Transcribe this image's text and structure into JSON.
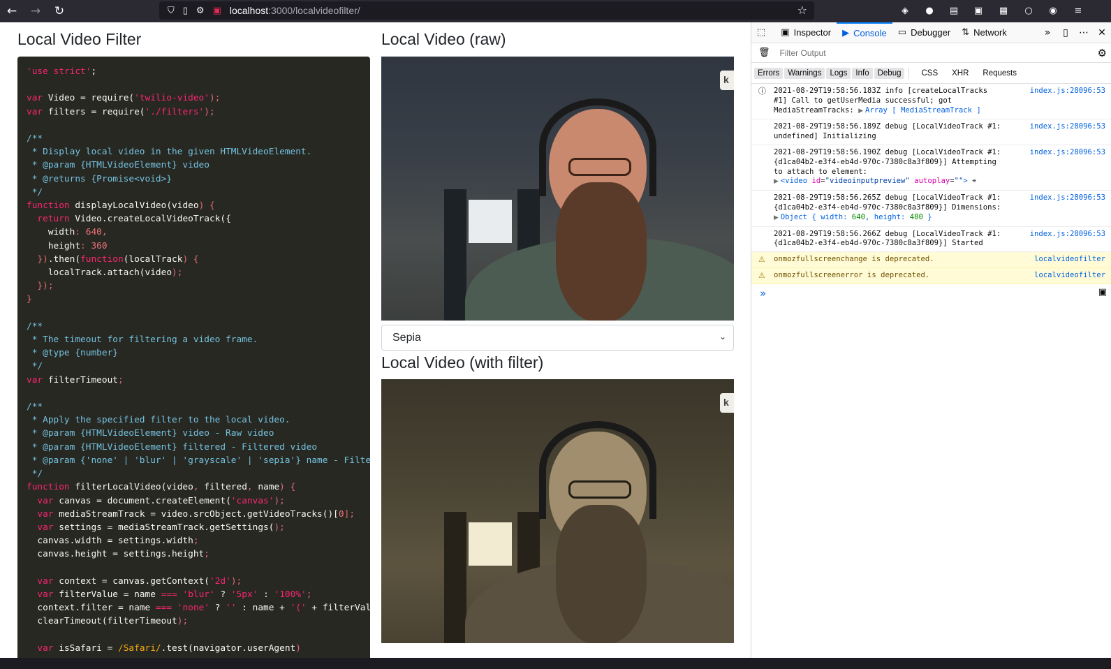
{
  "browser": {
    "url_host": "localhost",
    "url_rest": ":3000/localvideofilter/"
  },
  "page": {
    "left_title": "Local Video Filter",
    "raw_title": "Local Video (raw)",
    "filter_title": "Local Video (with filter)",
    "filter_select_value": "Sepia",
    "video_badge": "k"
  },
  "devtools": {
    "tabs": [
      "Inspector",
      "Console",
      "Debugger",
      "Network"
    ],
    "active_tab": "Console",
    "filter_placeholder": "Filter Output",
    "levels": [
      "Errors",
      "Warnings",
      "Logs",
      "Info",
      "Debug"
    ],
    "extra_filters": [
      "CSS",
      "XHR",
      "Requests"
    ],
    "messages": [
      {
        "type": "info",
        "source": "index.js:28096:53",
        "l1": "2021-08-29T19:58:56.183Z info [createLocalTracks",
        "l2": "#1] Call to getUserMedia successful; got",
        "l3a": "MediaStreamTracks: ",
        "l3b": "Array [ MediaStreamTrack ]"
      },
      {
        "type": "log",
        "source": "index.js:28096:53",
        "l1": "2021-08-29T19:58:56.189Z debug [LocalVideoTrack #1:",
        "l2": "undefined] Initializing"
      },
      {
        "type": "log",
        "source": "index.js:28096:53",
        "l1": "2021-08-29T19:58:56.190Z debug [LocalVideoTrack #1:",
        "l2": "{d1ca04b2-e3f4-eb4d-970c-7380c8a3f809}] Attempting",
        "l3": "to attach to element:",
        "tag_name": "video",
        "attr1": "id",
        "val1": "\"videoinputpreview\"",
        "attr2": "autoplay",
        "val2": "\"\""
      },
      {
        "type": "log",
        "source": "index.js:28096:53",
        "l1": "2021-08-29T19:58:56.265Z debug [LocalVideoTrack #1:",
        "l2": "{d1ca04b2-e3f4-eb4d-970c-7380c8a3f809}] Dimensions:",
        "obj": "Object { width: ",
        "w": "640",
        "mid": ", height: ",
        "h": "480",
        "end": " }"
      },
      {
        "type": "log",
        "source": "index.js:28096:53",
        "l1": "2021-08-29T19:58:56.266Z debug [LocalVideoTrack #1:",
        "l2": "{d1ca04b2-e3f4-eb4d-970c-7380c8a3f809}] Started"
      },
      {
        "type": "warn",
        "source": "localvideofilter",
        "l1": "onmozfullscreenchange is deprecated."
      },
      {
        "type": "warn",
        "source": "localvideofilter",
        "l1": "onmozfullscreenerror is deprecated."
      }
    ]
  },
  "code_lines": [
    [
      [
        "tk-str2",
        "'use strict'"
      ],
      [
        "",
        "; "
      ]
    ],
    [],
    [
      [
        "tk-kw",
        "var"
      ],
      [
        "",
        " Video = require("
      ],
      [
        "tk-str2",
        "'twilio-video'"
      ],
      [
        "tk-pun",
        ");"
      ]
    ],
    [
      [
        "tk-kw",
        "var"
      ],
      [
        "",
        " filters = require("
      ],
      [
        "tk-str2",
        "'./filters'"
      ],
      [
        "tk-pun",
        ");"
      ]
    ],
    [],
    [
      [
        "tk-cm",
        "/**"
      ]
    ],
    [
      [
        "tk-cm",
        " * Display local video in the given HTMLVideoElement."
      ]
    ],
    [
      [
        "tk-cm",
        " * @param {HTMLVideoElement} video"
      ]
    ],
    [
      [
        "tk-cm",
        " * @returns {Promise<void>}"
      ]
    ],
    [
      [
        "tk-cm",
        " */"
      ]
    ],
    [
      [
        "tk-kw",
        "function"
      ],
      [
        "",
        " displayLocalVideo("
      ],
      [
        "",
        "video"
      ],
      [
        "tk-pun",
        ") {"
      ]
    ],
    [
      [
        "",
        "  "
      ],
      [
        "tk-kw",
        "return"
      ],
      [
        "",
        " Video.createLocalVideoTrack({"
      ]
    ],
    [
      [
        "",
        "    width"
      ],
      [
        "tk-pun",
        ": "
      ],
      [
        "tk-num",
        "640"
      ],
      [
        "tk-pun",
        ","
      ]
    ],
    [
      [
        "",
        "    height"
      ],
      [
        "tk-pun",
        ": "
      ],
      [
        "tk-num",
        "360"
      ]
    ],
    [
      [
        "tk-pun",
        "  })"
      ],
      [
        "",
        ".then("
      ],
      [
        "tk-kw",
        "function"
      ],
      [
        "",
        "(localTrack"
      ],
      [
        "tk-pun",
        ") {"
      ]
    ],
    [
      [
        "",
        "    localTrack.attach(video"
      ],
      [
        "tk-pun",
        ");"
      ]
    ],
    [
      [
        "tk-pun",
        "  });"
      ]
    ],
    [
      [
        "tk-pun",
        "}"
      ]
    ],
    [],
    [
      [
        "tk-cm",
        "/**"
      ]
    ],
    [
      [
        "tk-cm",
        " * The timeout for filtering a video frame."
      ]
    ],
    [
      [
        "tk-cm",
        " * @type {number}"
      ]
    ],
    [
      [
        "tk-cm",
        " */"
      ]
    ],
    [
      [
        "tk-kw",
        "var"
      ],
      [
        "",
        " filterTimeout"
      ],
      [
        "tk-pun",
        ";"
      ]
    ],
    [],
    [
      [
        "tk-cm",
        "/**"
      ]
    ],
    [
      [
        "tk-cm",
        " * Apply the specified filter to the local video."
      ]
    ],
    [
      [
        "tk-cm",
        " * @param {HTMLVideoElement} video - Raw video"
      ]
    ],
    [
      [
        "tk-cm",
        " * @param {HTMLVideoElement} filtered - Filtered video"
      ]
    ],
    [
      [
        "tk-cm",
        " * @param {'none' | 'blur' | 'grayscale' | 'sepia'} name - Filte"
      ]
    ],
    [
      [
        "tk-cm",
        " */"
      ]
    ],
    [
      [
        "tk-kw",
        "function"
      ],
      [
        "",
        " filterLocalVideo(video"
      ],
      [
        "tk-pun",
        ", "
      ],
      [
        "",
        "filtered"
      ],
      [
        "tk-pun",
        ", "
      ],
      [
        "",
        "name"
      ],
      [
        "tk-pun",
        ") {"
      ]
    ],
    [
      [
        "",
        "  "
      ],
      [
        "tk-kw",
        "var"
      ],
      [
        "",
        " canvas = document.createElement("
      ],
      [
        "tk-str2",
        "'canvas'"
      ],
      [
        "tk-pun",
        ");"
      ]
    ],
    [
      [
        "",
        "  "
      ],
      [
        "tk-kw",
        "var"
      ],
      [
        "",
        " mediaStreamTrack = video.srcObject.getVideoTracks()["
      ],
      [
        "tk-num",
        "0"
      ],
      [
        "tk-pun",
        "];"
      ]
    ],
    [
      [
        "",
        "  "
      ],
      [
        "tk-kw",
        "var"
      ],
      [
        "",
        " settings = mediaStreamTrack.getSettings("
      ],
      [
        "tk-pun",
        ");"
      ]
    ],
    [
      [
        "",
        "  canvas.width = settings.width"
      ],
      [
        "tk-pun",
        ";"
      ]
    ],
    [
      [
        "",
        "  canvas.height = settings.height"
      ],
      [
        "tk-pun",
        ";"
      ]
    ],
    [],
    [
      [
        "",
        "  "
      ],
      [
        "tk-kw",
        "var"
      ],
      [
        "",
        " context = canvas.getContext("
      ],
      [
        "tk-str2",
        "'2d'"
      ],
      [
        "tk-pun",
        ");"
      ]
    ],
    [
      [
        "",
        "  "
      ],
      [
        "tk-kw",
        "var"
      ],
      [
        "",
        " filterValue = name "
      ],
      [
        "tk-kw",
        "==="
      ],
      [
        "",
        " "
      ],
      [
        "tk-str2",
        "'blur'"
      ],
      [
        "",
        " ? "
      ],
      [
        "tk-str2",
        "'5px'"
      ],
      [
        "",
        " : "
      ],
      [
        "tk-str2",
        "'100%'"
      ],
      [
        "tk-pun",
        ";"
      ]
    ],
    [
      [
        "",
        "  context.filter = name "
      ],
      [
        "tk-kw",
        "==="
      ],
      [
        "",
        " "
      ],
      [
        "tk-str2",
        "'none'"
      ],
      [
        "",
        " ? "
      ],
      [
        "tk-str2",
        "''"
      ],
      [
        "",
        " : name + "
      ],
      [
        "tk-str2",
        "'('"
      ],
      [
        "",
        " + filterVal"
      ]
    ],
    [
      [
        "",
        "  clearTimeout(filterTimeout"
      ],
      [
        "tk-pun",
        ");"
      ]
    ],
    [],
    [
      [
        "",
        "  "
      ],
      [
        "tk-kw",
        "var"
      ],
      [
        "",
        " isSafari = "
      ],
      [
        "tk-re",
        "/Safari/"
      ],
      [
        "",
        ".test(navigator.userAgent"
      ],
      [
        "tk-pun",
        ")"
      ]
    ]
  ]
}
